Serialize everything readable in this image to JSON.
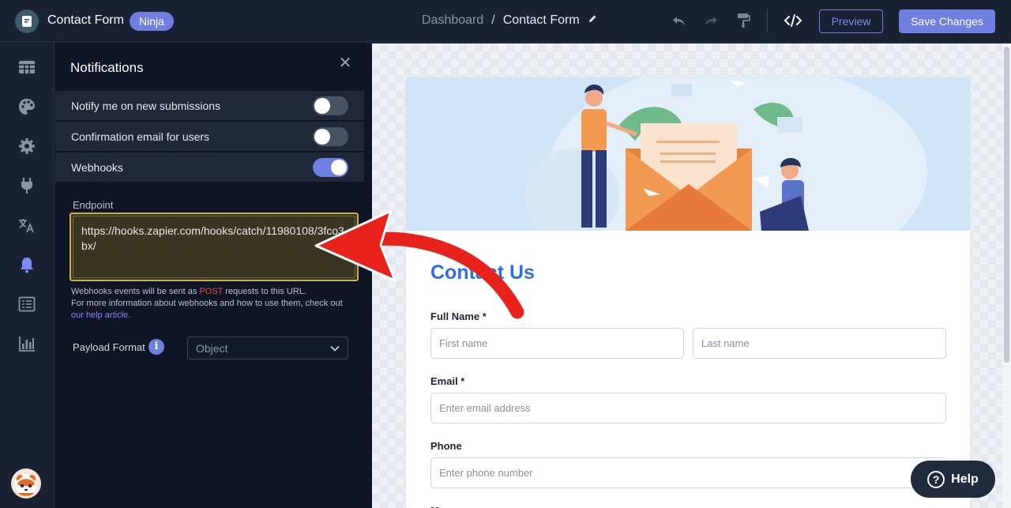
{
  "app": {
    "title": "Contact Form",
    "badge": "Ninja"
  },
  "breadcrumb": {
    "root": "Dashboard",
    "separator": "/",
    "current": "Contact Form"
  },
  "toolbar": {
    "preview_label": "Preview",
    "save_label": "Save Changes"
  },
  "rail": {
    "items": [
      {
        "icon": "table-icon"
      },
      {
        "icon": "palette-icon"
      },
      {
        "icon": "gear-icon"
      },
      {
        "icon": "plug-icon"
      },
      {
        "icon": "translate-icon"
      },
      {
        "icon": "bell-icon",
        "active": true
      },
      {
        "icon": "list-icon"
      },
      {
        "icon": "chart-icon"
      }
    ]
  },
  "panel": {
    "title": "Notifications",
    "options": [
      {
        "label": "Notify me on new submissions",
        "enabled": false
      },
      {
        "label": "Confirmation email for users",
        "enabled": false
      },
      {
        "label": "Webhooks",
        "enabled": true
      }
    ],
    "endpoint_label": "Endpoint",
    "endpoint_value": "https://hooks.zapier.com/hooks/catch/11980108/3fco3bx/",
    "help_prefix": "Webhooks events will be sent as ",
    "help_post": "POST",
    "help_suffix": " requests to this URL.",
    "help_line2": "For more information about webhooks and how to use them, check out",
    "help_link": "our help article.",
    "payload_label": "Payload Format",
    "payload_value": "Object"
  },
  "form": {
    "title": "Contact Us",
    "full_name_label": "Full Name *",
    "first_name_placeholder": "First name",
    "last_name_placeholder": "Last name",
    "email_label": "Email *",
    "email_placeholder": "Enter email address",
    "phone_label": "Phone",
    "phone_placeholder": "Enter phone number",
    "next_label": "M"
  },
  "help_button": {
    "label": "Help"
  },
  "colors": {
    "accent": "#6f7fe0",
    "topbar": "#1a2132",
    "panel": "#0f1524",
    "form_title": "#2f6fe0",
    "annotation_arrow": "#e8231c"
  }
}
